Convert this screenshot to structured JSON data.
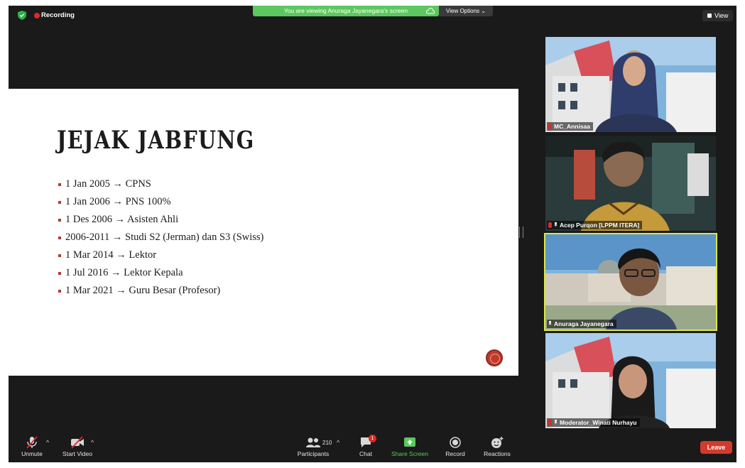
{
  "top_bar": {
    "recording_label": "Recording",
    "banner_text": "You are viewing Anuraga Jayanegara's screen",
    "view_options_label": "View Options ⌄",
    "view_label": "View"
  },
  "slide": {
    "title": "JEJAK JABFUNG",
    "bullets": [
      "1 Jan 2005 → CPNS",
      "1 Jan 2006 → PNS 100%",
      "1 Des 2006 → Asisten Ahli",
      "2006-2011 → Studi S2 (Jerman) dan S3 (Swiss)",
      "1 Mar 2014 → Lektor",
      "1 Jul 2016 → Lektor Kepala",
      "1 Mar 2021 → Guru Besar (Profesor)"
    ]
  },
  "participants": [
    {
      "name": "MC_Annisaa",
      "muted": true
    },
    {
      "name": "Acep Purqon [LPPM ITERA]",
      "muted": true
    },
    {
      "name": "Anuraga Jayanegara",
      "muted": false,
      "active_speaker": true
    },
    {
      "name": "Moderator_Winati Nurhayu",
      "muted": true
    }
  ],
  "toolbar": {
    "unmute_label": "Unmute",
    "start_video_label": "Start Video",
    "participants_label": "Participants",
    "participants_count": "210",
    "chat_label": "Chat",
    "chat_badge": "1",
    "share_screen_label": "Share Screen",
    "record_label": "Record",
    "reactions_label": "Reactions",
    "leave_label": "Leave"
  },
  "colors": {
    "accent_green": "#5cc85e",
    "leave_red": "#d33a2c",
    "active_speaker_border": "#d9e84a",
    "bullet_red": "#b23a3a"
  }
}
